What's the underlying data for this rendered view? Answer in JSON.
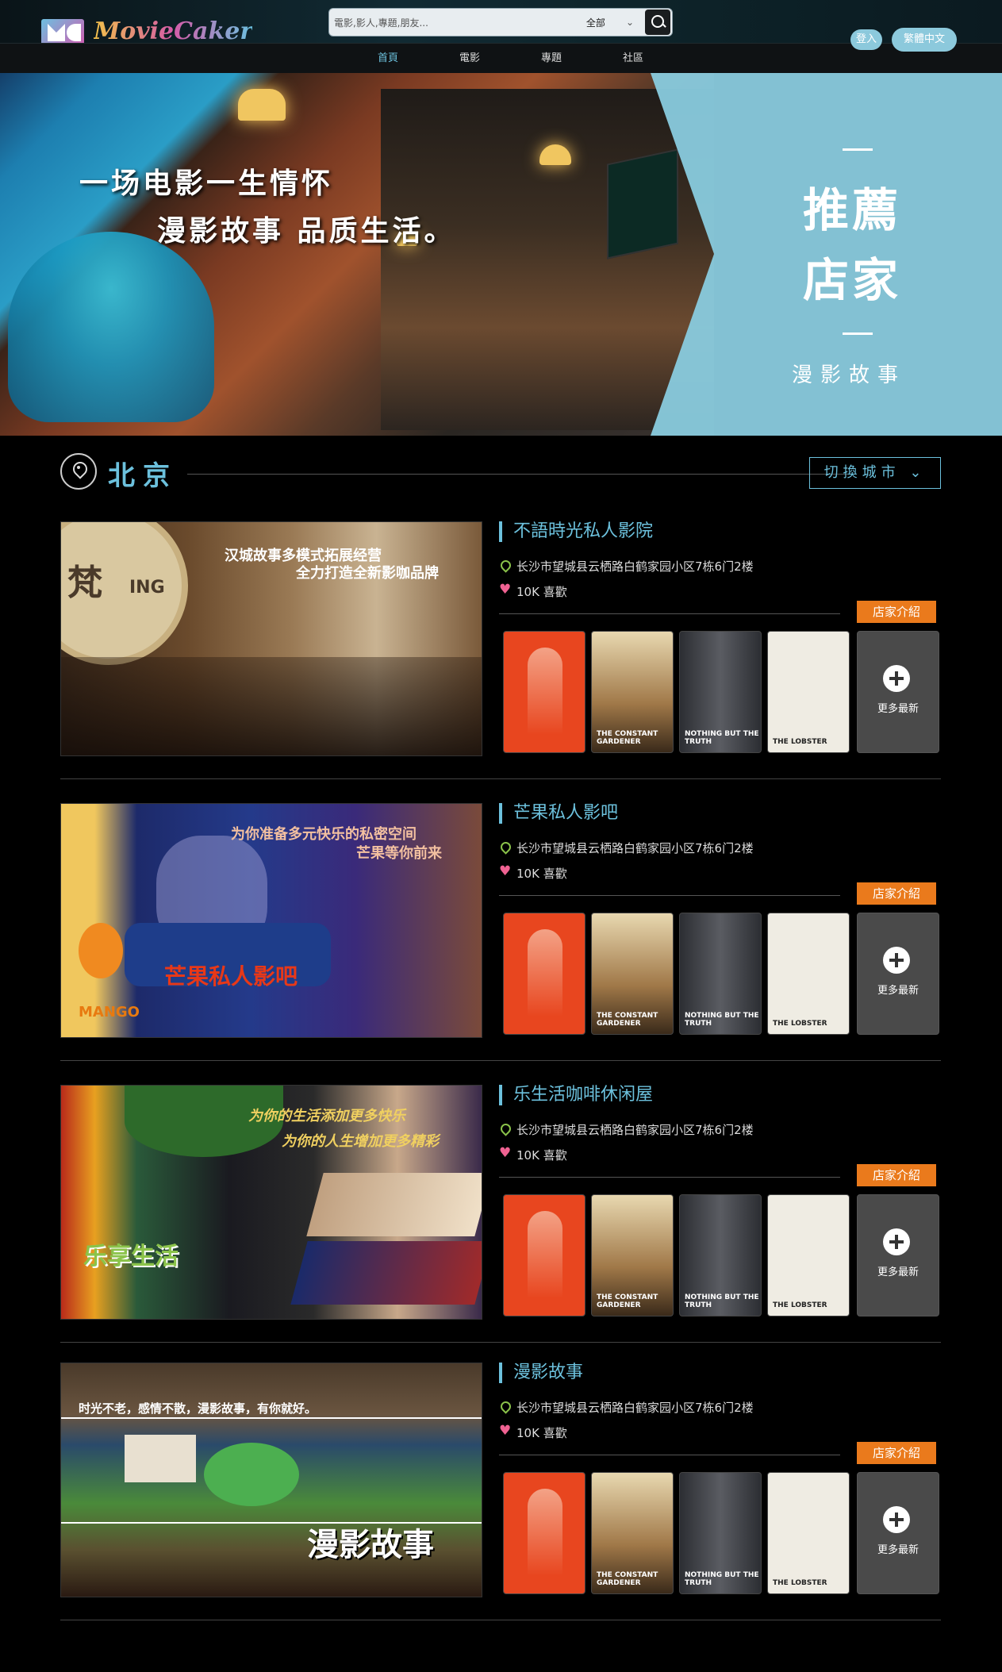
{
  "header": {
    "logo_text": "MovieCaker",
    "search_placeholder": "電影,影人,專題,朋友...",
    "search_category": "全部",
    "nav": [
      "首頁",
      "電影",
      "專題",
      "社區"
    ],
    "login": "登入",
    "language": "繁體中文"
  },
  "hero": {
    "slogan_line1": "一场电影一生情怀",
    "slogan_line2": "漫影故事  品质生活。",
    "panel_line1": "推薦",
    "panel_line2": "店家",
    "panel_sub": "漫影故事",
    "accent": "#89cbde"
  },
  "city": {
    "name": "北京",
    "switch_label": "切換城市"
  },
  "stores": [
    {
      "name": "不語時光私人影院",
      "address": "长沙市望城县云栖路白鹤家园小区7栋6门2楼",
      "likes": "10K 喜歡",
      "intro": "店家介紹",
      "more": "更多最新",
      "cover_texts": [
        "汉城故事多模式拓展经营",
        "全力打造全新影咖品牌"
      ]
    },
    {
      "name": "芒果私人影吧",
      "address": "长沙市望城县云栖路白鹤家园小区7栋6门2楼",
      "likes": "10K 喜歡",
      "intro": "店家介紹",
      "more": "更多最新",
      "cover_texts": [
        "为你准备多元快乐的私密空间",
        "芒果等你前来",
        "芒果私人影吧"
      ]
    },
    {
      "name": "乐生活咖啡休闲屋",
      "address": "长沙市望城县云栖路白鹤家园小区7栋6门2楼",
      "likes": "10K 喜歡",
      "intro": "店家介紹",
      "more": "更多最新",
      "cover_texts": [
        "为你的生活添加更多快乐",
        "为你的人生增加更多精彩",
        "乐享生活"
      ]
    },
    {
      "name": "漫影故事",
      "address": "长沙市望城县云栖路白鹤家园小区7栋6门2楼",
      "likes": "10K 喜歡",
      "intro": "店家介紹",
      "more": "更多最新",
      "cover_texts": [
        "时光不老，感情不散，漫影故事，有你就好。",
        "漫影故事"
      ]
    }
  ],
  "posters": [
    {
      "title": "",
      "bg": "#e8461f",
      "icon": "kanal-poster"
    },
    {
      "title": "THE CONSTANT GARDENER",
      "bg": "#c7a16a",
      "icon": "constant-gardener-poster"
    },
    {
      "title": "NOTHING BUT THE TRUTH",
      "bg": "#3d3f44",
      "icon": "nothing-but-the-truth-poster"
    },
    {
      "title": "THE LOBSTER",
      "bg": "#efece3",
      "icon": "the-lobster-poster"
    }
  ]
}
